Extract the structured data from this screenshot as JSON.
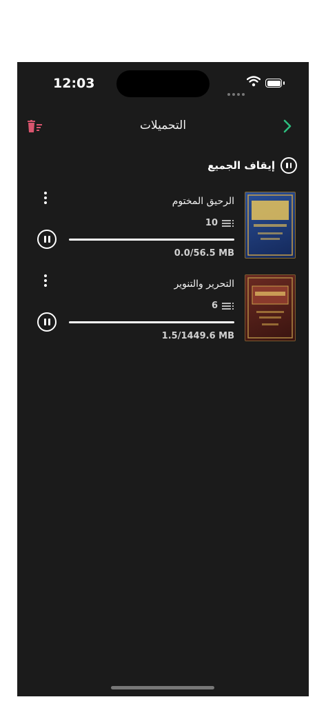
{
  "status": {
    "time": "12:03"
  },
  "header": {
    "title": "التحميلات"
  },
  "stop_all": {
    "label": "إيقاف الجميع"
  },
  "downloads": [
    {
      "title": "الرحيق المختوم",
      "count": "10",
      "size": "0.0/56.5 MB",
      "progress": 0.0,
      "cover_color": "#1e3d7a"
    },
    {
      "title": "التحرير والتنوير",
      "count": "6",
      "size": "1.5/1449.6 MB",
      "progress": 0.001,
      "cover_color": "#5a1f1a"
    }
  ],
  "colors": {
    "background": "#1b1b1b",
    "accent_green": "#2dbd7e",
    "trash_red": "#d9556e"
  },
  "icons": {
    "back": "chevron-right-icon",
    "delete_all": "trash-list-icon",
    "pause": "pause-circle-icon",
    "menu": "more-vertical-icon",
    "count": "list-icon"
  }
}
